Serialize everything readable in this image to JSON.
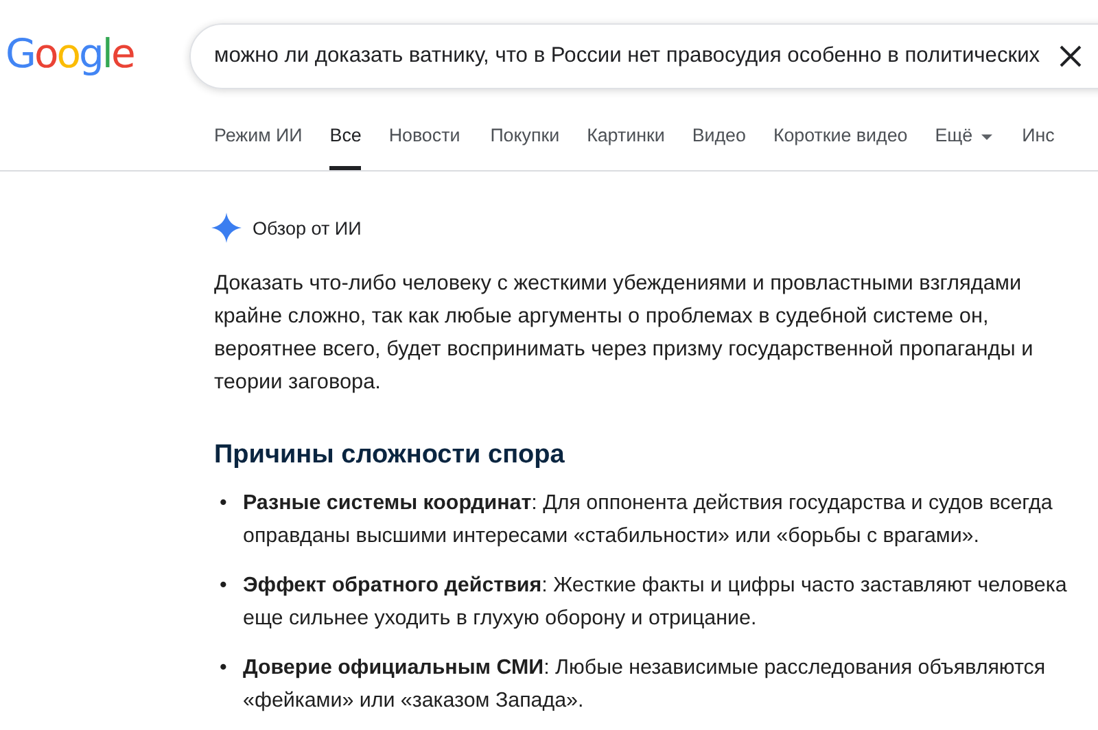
{
  "logo": {
    "text": "Google"
  },
  "search": {
    "value": "можно ли доказать ватнику, что в России нет правосудия особенно в политических"
  },
  "tabs": [
    {
      "label": "Режим ИИ",
      "selected": false,
      "kind": "plain"
    },
    {
      "label": "Все",
      "selected": true,
      "kind": "plain"
    },
    {
      "label": "Новости",
      "selected": false,
      "kind": "plain"
    },
    {
      "label": "Покупки",
      "selected": false,
      "kind": "plain"
    },
    {
      "label": "Картинки",
      "selected": false,
      "kind": "plain"
    },
    {
      "label": "Видео",
      "selected": false,
      "kind": "plain"
    },
    {
      "label": "Короткие видео",
      "selected": false,
      "kind": "plain"
    },
    {
      "label": "Ещё",
      "selected": false,
      "kind": "menu"
    },
    {
      "label": "Инс",
      "selected": false,
      "kind": "plain"
    }
  ],
  "ai_overview": {
    "title": "Обзор от ИИ",
    "summary": "Доказать что-либо человеку с жесткими убеждениями и провластными взглядами крайне сложно, так как любые аргументы о проблемах в судебной системе он, вероятнее всего, будет воспринимать через призму государственной пропаганды и теории заговора.",
    "heading": "Причины сложности спора",
    "points": [
      {
        "marker": "•",
        "text": "**Разные системы координат**: Для оппонента действия государства и судов всегда оправданы высшими интересами «стабильности» или «борьбы с врагами»."
      },
      {
        "marker": "•",
        "text": "**Эффект обратного действия**: Жесткие факты и цифры часто заставляют человека еще сильнее уходить в глухую оборону и отрицание."
      },
      {
        "marker": "•",
        "text": "**Доверие официальным СМИ**: Любые независимые расследования объявляются «фейками» или «заказом Запада»."
      }
    ]
  }
}
